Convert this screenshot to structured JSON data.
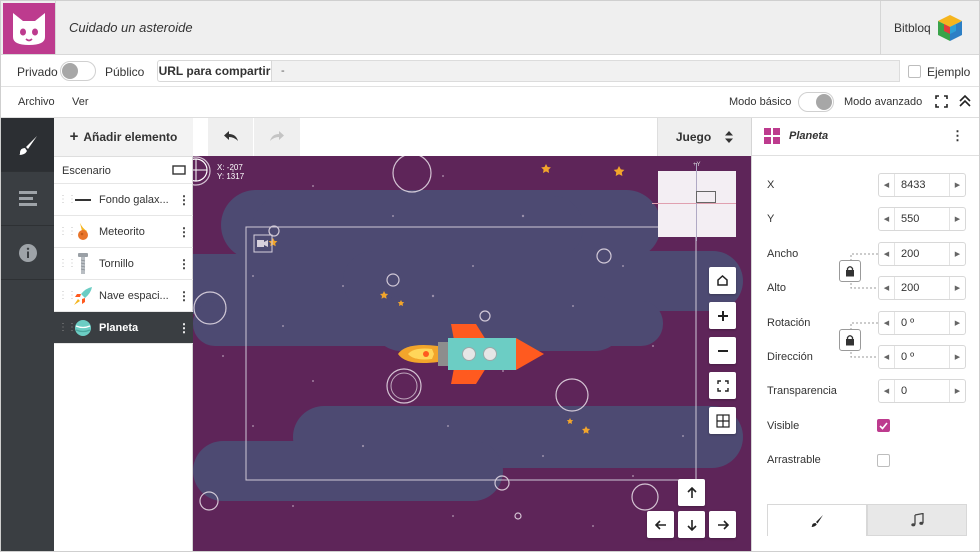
{
  "header": {
    "title": "Cuidado un asteroide",
    "brand": "Bitbloq"
  },
  "share": {
    "private_label": "Privado",
    "public_label": "Público",
    "url_button": "URL para compartir",
    "url_value": "-",
    "example_label": "Ejemplo"
  },
  "menu": {
    "file": "Archivo",
    "view": "Ver",
    "basic_mode": "Modo básico",
    "advanced_mode": "Modo avanzado"
  },
  "objects": {
    "add_label": "Añadir elemento",
    "scene_label": "Escenario",
    "items": [
      {
        "label": "Fondo galax...",
        "icon": "line-icon"
      },
      {
        "label": "Meteorito",
        "icon": "meteor-icon"
      },
      {
        "label": "Tornillo",
        "icon": "screw-icon"
      },
      {
        "label": "Nave espaci...",
        "icon": "rocket-icon"
      },
      {
        "label": "Planeta",
        "icon": "planet-icon",
        "selected": true
      }
    ]
  },
  "toolbar": {
    "mode_label": "Juego"
  },
  "canvas": {
    "coord_x": "X: -207",
    "coord_y": "Y: 1317",
    "minimap_label": "+Y"
  },
  "properties": {
    "title": "Planeta",
    "fields": [
      {
        "label": "X",
        "value": "8433"
      },
      {
        "label": "Y",
        "value": "550"
      },
      {
        "label": "Ancho",
        "value": "200"
      },
      {
        "label": "Alto",
        "value": "200"
      },
      {
        "label": "Rotación",
        "value": "0 º"
      },
      {
        "label": "Dirección",
        "value": "0 º"
      },
      {
        "label": "Transparencia",
        "value": "0"
      }
    ],
    "visible_label": "Visible",
    "visible": true,
    "draggable_label": "Arrastrable",
    "draggable": false
  },
  "colors": {
    "brand": "#bd3b8e",
    "sidebar": "#3a3e42",
    "space": "#5e2559",
    "cloud": "#4d4a72",
    "rocket_body": "#6ccdc4",
    "rocket_fin": "#ff5a1f"
  }
}
